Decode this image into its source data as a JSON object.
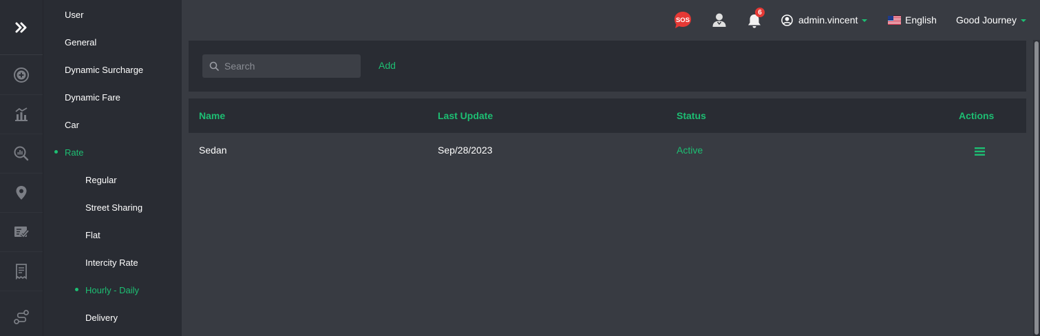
{
  "rail": {
    "expand_icon": "double-chevron-right-icon",
    "items": [
      {
        "icon": "plus-circle-icon"
      },
      {
        "icon": "bar-chart-icon"
      },
      {
        "icon": "search-analytics-icon"
      },
      {
        "icon": "location-pin-icon"
      },
      {
        "icon": "checklist-icon"
      },
      {
        "icon": "receipt-icon"
      },
      {
        "icon": "route-icon"
      }
    ]
  },
  "subnav": {
    "items": [
      {
        "label": "User"
      },
      {
        "label": "General"
      },
      {
        "label": "Dynamic Surcharge"
      },
      {
        "label": "Dynamic Fare"
      },
      {
        "label": "Car"
      },
      {
        "label": "Rate",
        "active": true
      },
      {
        "label": "Regular"
      },
      {
        "label": "Street Sharing"
      },
      {
        "label": "Flat"
      },
      {
        "label": "Intercity Rate"
      },
      {
        "label": "Hourly - Daily",
        "active": true
      },
      {
        "label": "Delivery"
      }
    ]
  },
  "header": {
    "sos_label": "SOS",
    "notification_count": "6",
    "username": "admin.vincent",
    "language": "English",
    "company": "Good Journey"
  },
  "toolbar": {
    "search_placeholder": "Search",
    "add_label": "Add"
  },
  "table": {
    "columns": [
      "Name",
      "Last Update",
      "Status",
      "Actions"
    ],
    "rows": [
      {
        "name": "Sedan",
        "last_update": "Sep/28/2023",
        "status": "Active",
        "action_icon": "hamburger-menu-icon"
      }
    ]
  },
  "colors": {
    "accent": "#1dbf73",
    "sos": "#e53935",
    "badge": "#e53935",
    "background": "#383b42",
    "panel": "#292c33"
  }
}
